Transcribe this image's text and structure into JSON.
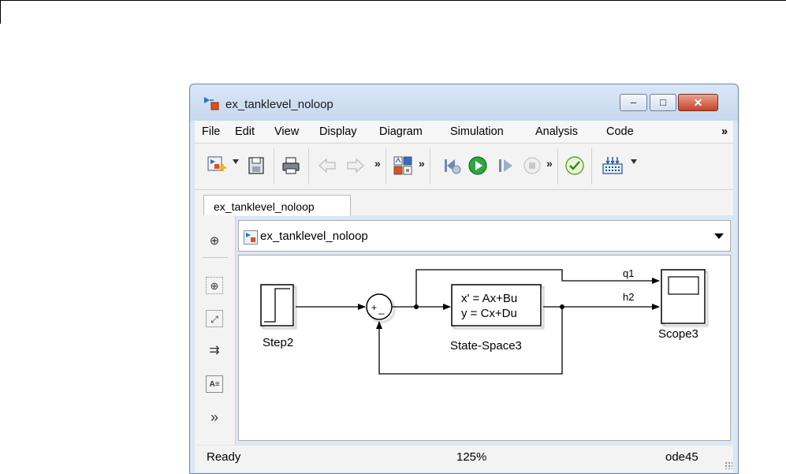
{
  "window": {
    "title": "ex_tanklevel_noloop",
    "buttons": {
      "minimize": "–",
      "maximize": "□",
      "close": "✕"
    }
  },
  "menu": {
    "items": [
      "File",
      "Edit",
      "View",
      "Display",
      "Diagram",
      "Simulation",
      "Analysis",
      "Code"
    ],
    "overflow": "»"
  },
  "toolbar": {
    "icons": [
      "new-model-icon",
      "save-icon",
      "print-icon",
      "back-icon",
      "forward-icon",
      "library-browser-icon",
      "step-back-icon",
      "run-icon",
      "step-forward-icon",
      "stop-icon",
      "model-advisor-icon",
      "build-icon"
    ],
    "overflow": "»"
  },
  "tab": {
    "label": "ex_tanklevel_noloop"
  },
  "address": {
    "path": "ex_tanklevel_noloop"
  },
  "left_palette": {
    "overflow": "»"
  },
  "diagram": {
    "blocks": {
      "step": "Step2",
      "statespace": "State-Space3",
      "statespace_eq1": "x' = Ax+Bu",
      "statespace_eq2": "y = Cx+Du",
      "scope": "Scope3",
      "sum_signs": [
        "+",
        "_"
      ]
    },
    "signals": [
      "q1",
      "h2"
    ]
  },
  "status": {
    "state": "Ready",
    "zoom": "125%",
    "solver": "ode45"
  }
}
